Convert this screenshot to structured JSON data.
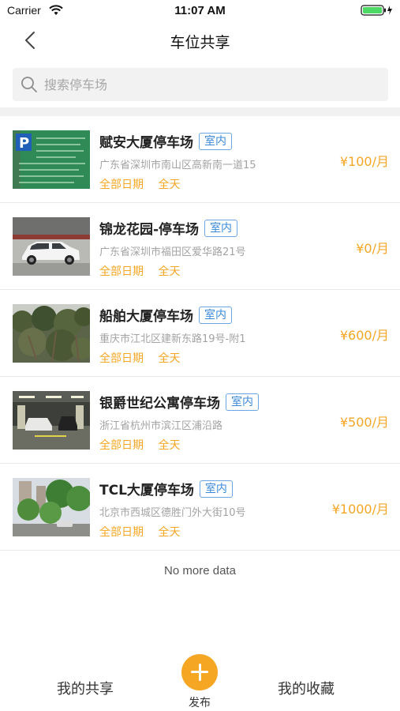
{
  "status_bar": {
    "carrier": "Carrier",
    "time": "11:07 AM"
  },
  "nav": {
    "title": "车位共享"
  },
  "search": {
    "placeholder": "搜索停车场"
  },
  "lots": [
    {
      "name": "赋安大厦停车场",
      "tag": "室内",
      "address": "广东省深圳市南山区高新南一道15",
      "date_label": "全部日期",
      "time_label": "全天",
      "price": "¥100/月",
      "image": "parking-sign-photo"
    },
    {
      "name": "锦龙花园-停车场",
      "tag": "室内",
      "address": "广东省深圳市福田区爱华路21号",
      "date_label": "全部日期",
      "time_label": "全天",
      "price": "¥0/月",
      "image": "white-suv-photo"
    },
    {
      "name": "船舶大厦停车场",
      "tag": "室内",
      "address": "重庆市江北区建新东路19号-附1",
      "date_label": "全部日期",
      "time_label": "全天",
      "price": "¥600/月",
      "image": "trees-photo"
    },
    {
      "name": "银爵世纪公寓停车场",
      "tag": "室内",
      "address": "浙江省杭州市滨江区浦沿路",
      "date_label": "全部日期",
      "time_label": "全天",
      "price": "¥500/月",
      "image": "underground-garage-photo"
    },
    {
      "name": "TCL大厦停车场",
      "tag": "室内",
      "address": "北京市西城区德胜门外大街10号",
      "date_label": "全部日期",
      "time_label": "全天",
      "price": "¥1000/月",
      "image": "street-trees-photo"
    }
  ],
  "footer_note": "No more data",
  "tab_bar": {
    "left_label": "我的共享",
    "publish_label": "发布",
    "right_label": "我的收藏"
  },
  "colors": {
    "accent": "#f5a623",
    "tag_blue": "#3b8ad9"
  }
}
